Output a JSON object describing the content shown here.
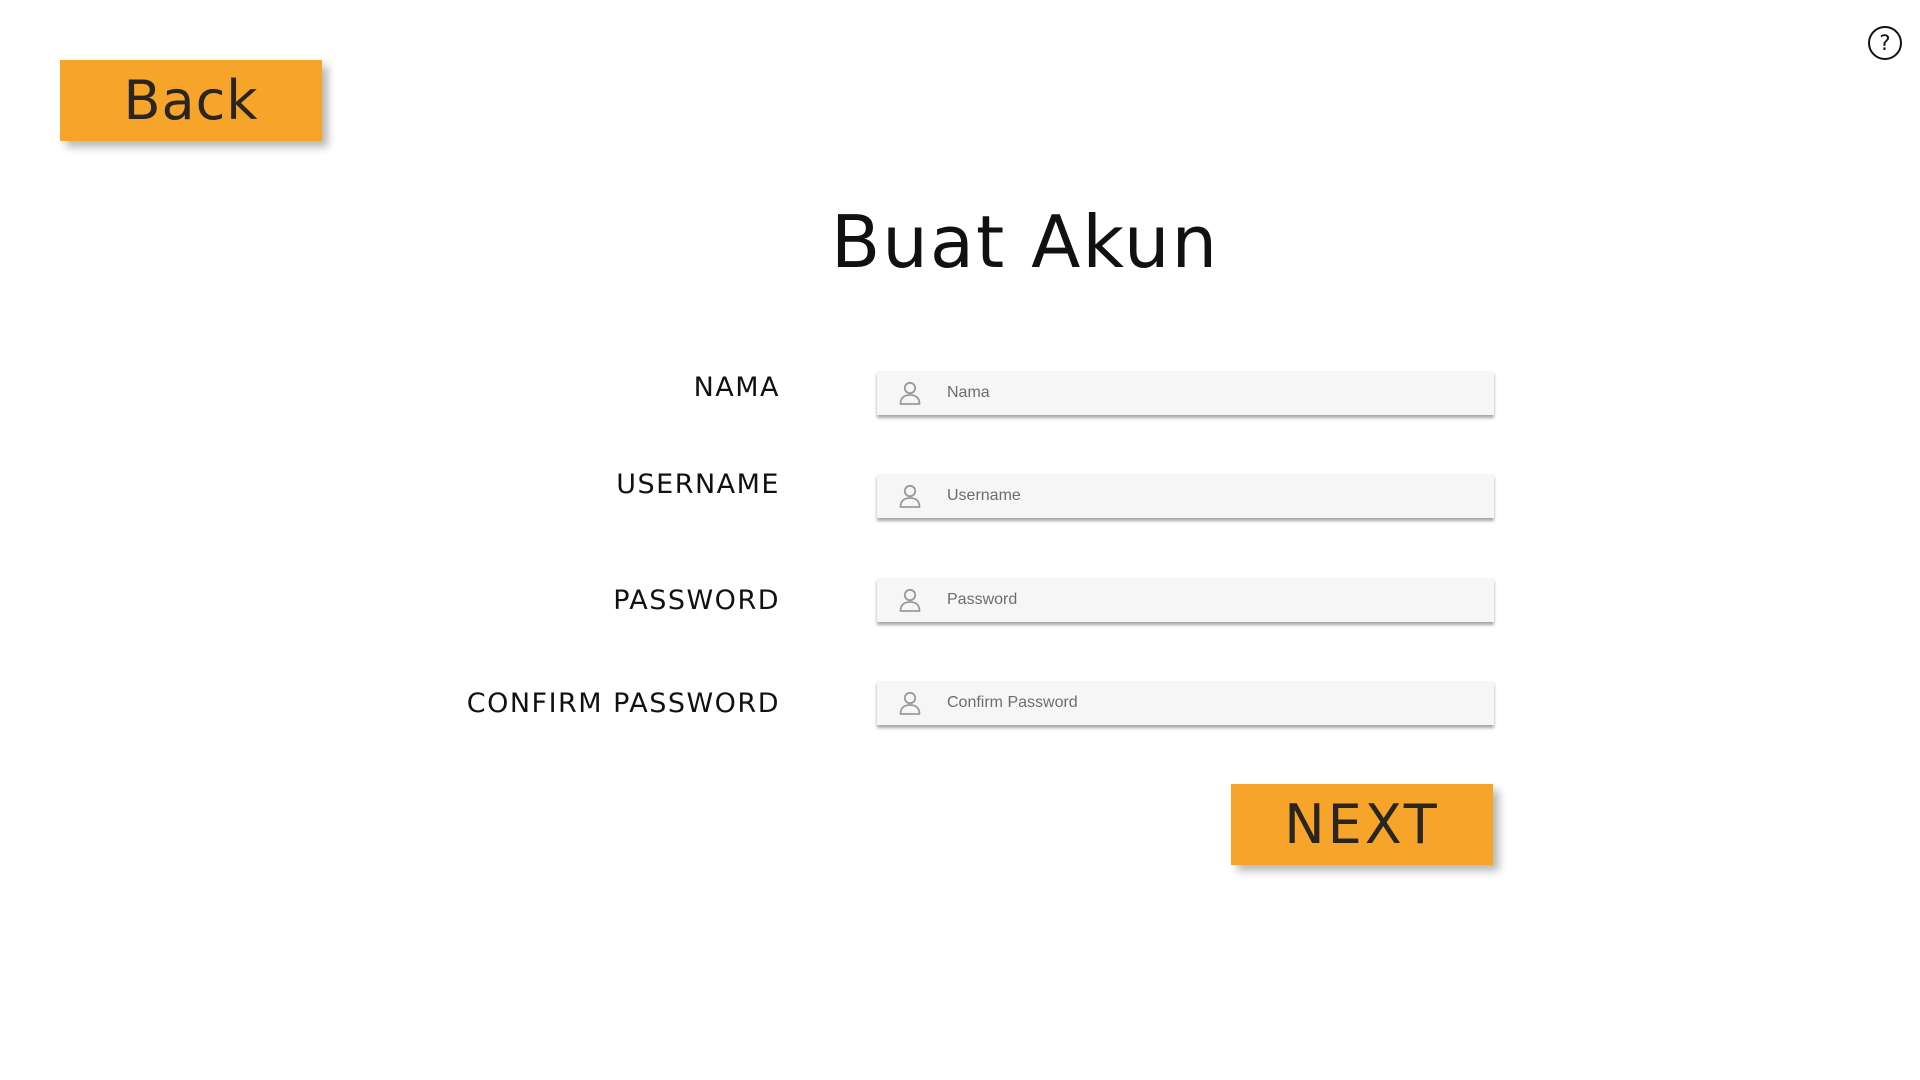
{
  "header": {
    "back_label": "Back",
    "help_symbol": "?",
    "help_icon": "question-circle-icon"
  },
  "title": "Buat Akun",
  "form": {
    "fields": [
      {
        "label": "NAMA",
        "placeholder": "Nama",
        "value": "",
        "icon": "user-icon"
      },
      {
        "label": "USERNAME",
        "placeholder": "Username",
        "value": "",
        "icon": "user-icon"
      },
      {
        "label": "PASSWORD",
        "placeholder": "Password",
        "value": "",
        "icon": "user-icon"
      },
      {
        "label": "CONFIRM PASSWORD",
        "placeholder": "Confirm Password",
        "value": "",
        "icon": "user-icon"
      }
    ],
    "next_label": "NEXT"
  },
  "colors": {
    "accent": "#f6a52a",
    "button_text": "#2a2520",
    "field_background": "#f6f6f6",
    "icon_gray": "#9a9a9a"
  }
}
